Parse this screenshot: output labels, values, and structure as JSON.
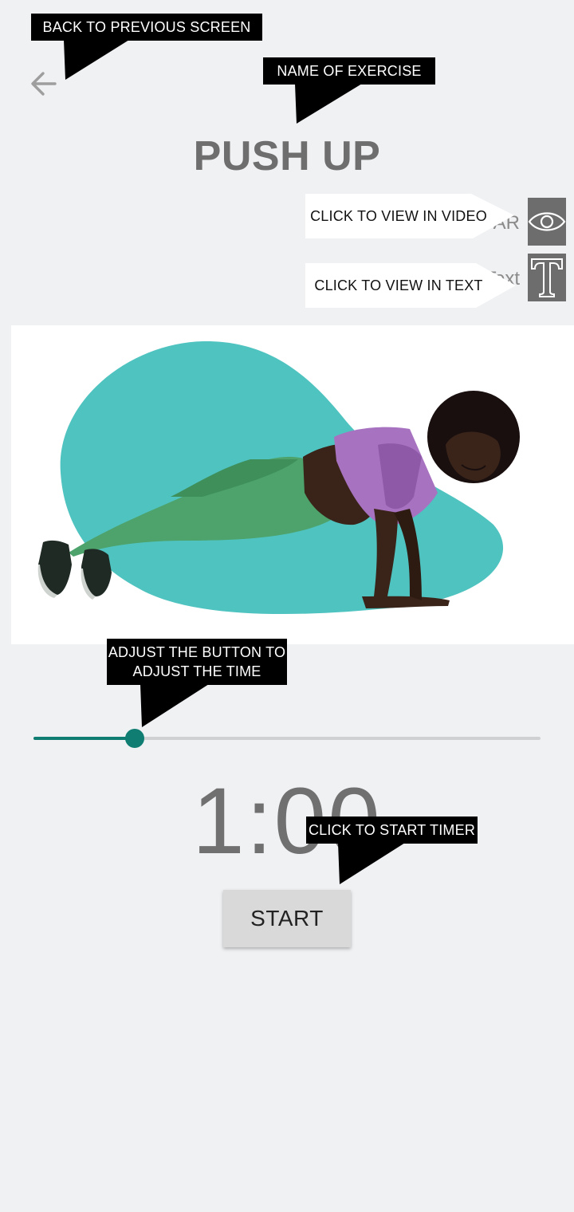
{
  "header": {
    "back_icon": "arrow-left-icon",
    "title": "PUSH UP"
  },
  "view_options": {
    "ar_label": "AR",
    "text_label": "Text",
    "video_icon": "eye-icon",
    "text_icon": "letter-t-icon"
  },
  "illustration": {
    "subject": "person-doing-push-up",
    "blob_color": "#4fc3c0"
  },
  "timer": {
    "value": "1:00",
    "slider_fraction": 0.2,
    "accent_color": "#0f7d72"
  },
  "actions": {
    "start_label": "START"
  },
  "annotations": {
    "back": "BACK TO PREVIOUS SCREEN",
    "name": "NAME OF EXERCISE",
    "video": "CLICK TO VIEW IN VIDEO",
    "text": "CLICK TO VIEW IN TEXT",
    "slider_line1": "ADJUST THE BUTTON TO",
    "slider_line2": "ADJUST THE TIME",
    "start": "CLICK TO START TIMER"
  }
}
